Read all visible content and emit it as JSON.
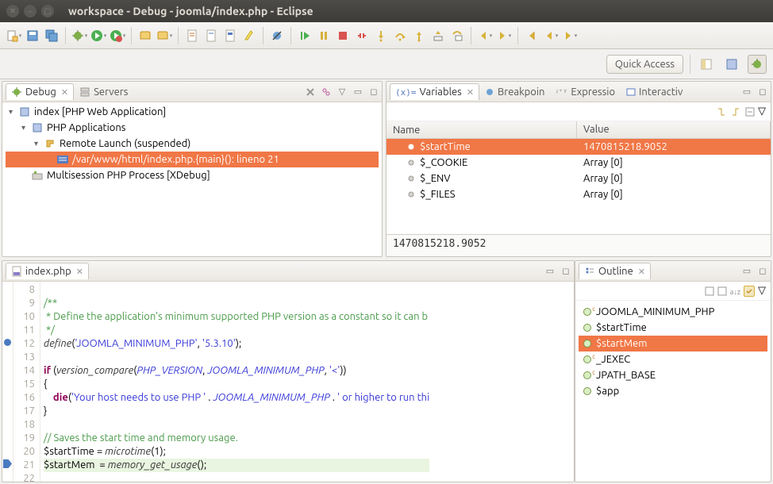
{
  "window": {
    "title": "workspace - Debug - joomla/index.php - Eclipse"
  },
  "quick_access": {
    "label": "Quick Access"
  },
  "debug_panel": {
    "tabs": [
      {
        "label": "Debug",
        "active": true
      },
      {
        "label": "Servers",
        "active": false
      }
    ],
    "tree": [
      {
        "depth": 0,
        "icon": "php-app",
        "label": "index [PHP Web Application]",
        "expand": "▾"
      },
      {
        "depth": 1,
        "icon": "php",
        "label": "PHP Applications",
        "expand": "▾"
      },
      {
        "depth": 2,
        "icon": "thread",
        "label": "Remote Launch (suspended)",
        "expand": "▾"
      },
      {
        "depth": 3,
        "icon": "frame",
        "label": "/var/www/html/index.php.{main}(): lineno 21",
        "selected": true
      },
      {
        "depth": 1,
        "icon": "proc",
        "label": "Multisession PHP Process [XDebug]"
      }
    ]
  },
  "vars_panel": {
    "tabs": [
      {
        "label": "Variables",
        "active": true
      },
      {
        "label": "Breakpoin",
        "active": false
      },
      {
        "label": "Expressio",
        "active": false
      },
      {
        "label": "Interactiv",
        "active": false
      }
    ],
    "columns": {
      "name": "Name",
      "value": "Value"
    },
    "rows": [
      {
        "name": "$startTime",
        "value": "1470815218.9052",
        "selected": true
      },
      {
        "name": "$_COOKIE",
        "value": "Array [0]"
      },
      {
        "name": "$_ENV",
        "value": "Array [0]"
      },
      {
        "name": "$_FILES",
        "value": "Array [0]"
      }
    ],
    "detail": "1470815218.9052"
  },
  "editor": {
    "tab": "index.php",
    "lines": [
      {
        "n": 8,
        "html": ""
      },
      {
        "n": 9,
        "html": "<span class='c-comment'>/**</span>"
      },
      {
        "n": 10,
        "html": "<span class='c-comment'> * Define the application's minimum supported PHP version as a constant so it can b</span>"
      },
      {
        "n": 11,
        "html": "<span class='c-comment'> */</span>"
      },
      {
        "n": 12,
        "html": "<span class='c-fn'>define</span>(<span class='c-str'>'JOOMLA_MINIMUM_PHP'</span>, <span class='c-str'>'5.3.10'</span>);",
        "bp": true
      },
      {
        "n": 13,
        "html": ""
      },
      {
        "n": 14,
        "html": "<span class='c-kw'>if</span> (<span class='c-fn'>version_compare</span>(<span class='c-const'>PHP_VERSION</span>, <span class='c-const'>JOOMLA_MINIMUM_PHP</span>, <span class='c-str'>'&lt;'</span>))"
      },
      {
        "n": 15,
        "html": "{"
      },
      {
        "n": 16,
        "html": "    <span class='c-kw'>die</span>(<span class='c-str'>'Your host needs to use PHP '</span> . <span class='c-const'>JOOMLA_MINIMUM_PHP</span> . <span class='c-str'>' or higher to run thi</span>"
      },
      {
        "n": 17,
        "html": "}"
      },
      {
        "n": 18,
        "html": ""
      },
      {
        "n": 19,
        "html": "<span class='c-comment'>// Saves the start time and memory usage.</span>"
      },
      {
        "n": 20,
        "html": "$startTime = <span class='c-fn'>microtime</span>(1);"
      },
      {
        "n": 21,
        "html": "$startMem  = <span class='c-fn'>memory_get_usage</span>();",
        "current": true,
        "ip": true
      },
      {
        "n": 22,
        "html": ""
      }
    ]
  },
  "outline": {
    "tab": "Outline",
    "items": [
      {
        "label": "JOOMLA_MINIMUM_PHP",
        "kind": "c"
      },
      {
        "label": "$startTime",
        "kind": "v"
      },
      {
        "label": "$startMem",
        "kind": "v",
        "selected": true
      },
      {
        "label": "_JEXEC",
        "kind": "c"
      },
      {
        "label": "JPATH_BASE",
        "kind": "c"
      },
      {
        "label": "$app",
        "kind": "v"
      }
    ]
  }
}
